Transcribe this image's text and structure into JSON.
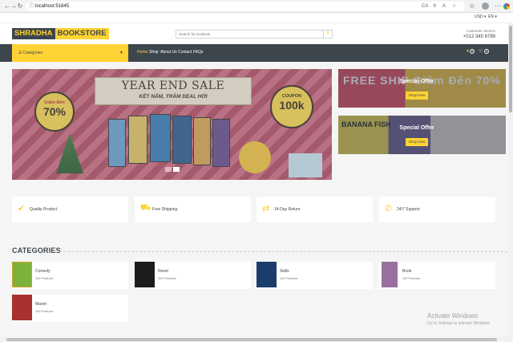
{
  "browser": {
    "url": "localhost:51845",
    "icons": [
      "back-icon",
      "forward-icon",
      "reload-icon",
      "lock-icon",
      "translate-icon",
      "zoom-icon",
      "star-icon",
      "extensions-icon",
      "profile-icon",
      "menu-icon",
      "edge-icon"
    ],
    "translate_label": "CA"
  },
  "topbar": {
    "currency": "USD ▾",
    "language": "EN ▾"
  },
  "header": {
    "logo_part1": "SHRADHA",
    "logo_part2": "BOOKSTORE",
    "search_placeholder": "Search for products",
    "customer_service_label": "Customer Service",
    "phone": "+012 345 6789"
  },
  "nav": {
    "categories_label": "☰  Categories",
    "links": [
      "Home",
      "Shop",
      "About Us",
      "Contact",
      "FAQs"
    ],
    "active": "Home",
    "wishlist_count": "0",
    "cart_count": "0"
  },
  "carousel": {
    "title": "YEAR END SALE",
    "subtitle": "KẾT NĂM, TRĂM DEAL HỜI",
    "left_badge_small": "Giảm Đến",
    "left_badge_big": "70%",
    "right_badge_small": "COUPON",
    "right_badge_big": "100k",
    "active_slide": 2,
    "slides": 2
  },
  "offers": [
    {
      "title": "Special Offer",
      "button": "Shop Now",
      "bg_text": "FREE SHIP   Giảm Đến 70%"
    },
    {
      "title": "Special Offer",
      "button": "Shop Now",
      "bg_text": "BANANA FISH"
    }
  ],
  "features": [
    {
      "icon": "check-icon",
      "label": "Quality Product"
    },
    {
      "icon": "truck-icon",
      "label": "Free Shipping"
    },
    {
      "icon": "exchange-icon",
      "label": "14-Day Return"
    },
    {
      "icon": "phone-icon",
      "label": "24/7 Support"
    }
  ],
  "categories": {
    "heading": "CATEGORIES",
    "items": [
      {
        "name": "Comedy",
        "count": "100 Products",
        "thumb_color": "#7db23a"
      },
      {
        "name": "Novel",
        "count": "100 Products",
        "thumb_color": "#1d1d1d"
      },
      {
        "name": "Skills",
        "count": "100 Products",
        "thumb_color": "#1b3d6b"
      },
      {
        "name": "Book",
        "count": "100 Products",
        "thumb_color": "#9a6fa0"
      },
      {
        "name": "Manet",
        "count": "100 Products",
        "thumb_color": "#a8322e"
      }
    ]
  },
  "watermark": {
    "line1": "Activate Windows",
    "line2": "Go to Settings to activate Windows."
  },
  "colors": {
    "accent": "#ffd333",
    "dark": "#3d464d",
    "background": "#f5f5f5"
  }
}
